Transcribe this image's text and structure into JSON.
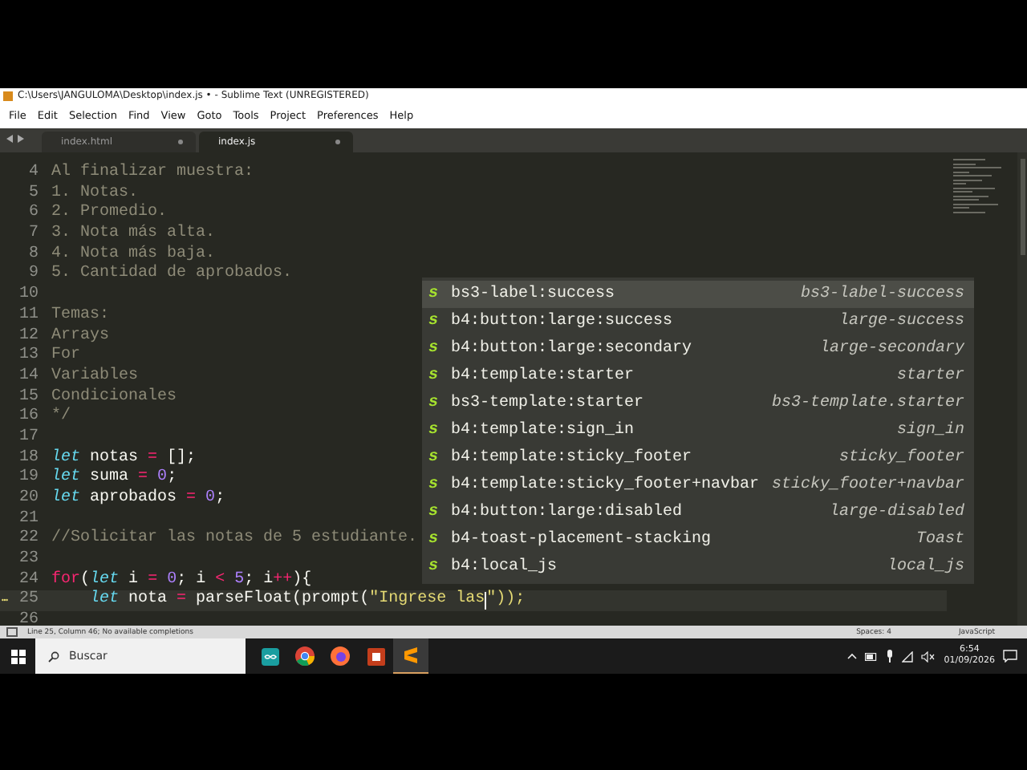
{
  "window": {
    "title": "C:\\Users\\JANGULOMA\\Desktop\\index.js • - Sublime Text (UNREGISTERED)"
  },
  "menu": [
    "File",
    "Edit",
    "Selection",
    "Find",
    "View",
    "Goto",
    "Tools",
    "Project",
    "Preferences",
    "Help"
  ],
  "tabs": [
    {
      "label": "index.html",
      "selected": false
    },
    {
      "label": "index.js",
      "selected": true
    }
  ],
  "editor": {
    "lines": [
      {
        "number": "4",
        "current": false,
        "modified": false,
        "tokens": [
          {
            "kind": "comment",
            "text": "Al finalizar muestra:"
          }
        ]
      },
      {
        "number": "5",
        "current": false,
        "modified": false,
        "tokens": [
          {
            "kind": "comment",
            "text": "1. Notas."
          }
        ]
      },
      {
        "number": "6",
        "current": false,
        "modified": false,
        "tokens": [
          {
            "kind": "comment",
            "text": "2. Promedio."
          }
        ]
      },
      {
        "number": "7",
        "current": false,
        "modified": false,
        "tokens": [
          {
            "kind": "comment",
            "text": "3. Nota más alta."
          }
        ]
      },
      {
        "number": "8",
        "current": false,
        "modified": false,
        "tokens": [
          {
            "kind": "comment",
            "text": "4. Nota más baja."
          }
        ]
      },
      {
        "number": "9",
        "current": false,
        "modified": false,
        "tokens": [
          {
            "kind": "comment",
            "text": "5. Cantidad de aprobados."
          }
        ]
      },
      {
        "number": "10",
        "current": false,
        "modified": false
      },
      {
        "number": "11",
        "current": false,
        "modified": false,
        "tokens": [
          {
            "kind": "comment",
            "text": "Temas:"
          }
        ]
      },
      {
        "number": "12",
        "current": false,
        "modified": false,
        "tokens": [
          {
            "kind": "comment",
            "text": "Arrays"
          }
        ]
      },
      {
        "number": "13",
        "current": false,
        "modified": false,
        "tokens": [
          {
            "kind": "comment",
            "text": "For"
          }
        ]
      },
      {
        "number": "14",
        "current": false,
        "modified": false,
        "tokens": [
          {
            "kind": "comment",
            "text": "Variables"
          }
        ]
      },
      {
        "number": "15",
        "current": false,
        "modified": false,
        "tokens": [
          {
            "kind": "comment",
            "text": "Condicionales"
          }
        ]
      },
      {
        "number": "16",
        "current": false,
        "modified": false,
        "tokens": [
          {
            "kind": "comment",
            "text": "*/"
          }
        ]
      },
      {
        "number": "17",
        "current": false,
        "modified": false
      },
      {
        "number": "18",
        "current": false,
        "modified": false,
        "tokens": [
          {
            "kind": "keyword",
            "text": "let"
          },
          {
            "kind": "plain",
            "text": " notas "
          },
          {
            "kind": "operator",
            "text": "="
          },
          {
            "kind": "plain",
            "text": " [];"
          }
        ]
      },
      {
        "number": "19",
        "current": false,
        "modified": false,
        "tokens": [
          {
            "kind": "keyword",
            "text": "let"
          },
          {
            "kind": "plain",
            "text": " suma "
          },
          {
            "kind": "operator",
            "text": "="
          },
          {
            "kind": "number",
            "text": " 0"
          },
          {
            "kind": "plain",
            "text": ";"
          }
        ]
      },
      {
        "number": "20",
        "current": false,
        "modified": false,
        "tokens": [
          {
            "kind": "keyword",
            "text": "let"
          },
          {
            "kind": "plain",
            "text": " aprobados "
          },
          {
            "kind": "operator",
            "text": "="
          },
          {
            "kind": "number",
            "text": " 0"
          },
          {
            "kind": "plain",
            "text": ";"
          }
        ]
      },
      {
        "number": "21",
        "current": false,
        "modified": false
      },
      {
        "number": "22",
        "current": false,
        "modified": false,
        "tokens": [
          {
            "kind": "comment",
            "text": "//Solicitar las notas de 5 estudiante."
          }
        ]
      },
      {
        "number": "23",
        "current": false,
        "modified": false
      },
      {
        "number": "24",
        "current": false,
        "modified": false,
        "tokens": [
          {
            "kind": "control",
            "text": "for"
          },
          {
            "kind": "plain",
            "text": "("
          },
          {
            "kind": "keyword",
            "text": "let"
          },
          {
            "kind": "plain",
            "text": " i "
          },
          {
            "kind": "operator",
            "text": "="
          },
          {
            "kind": "number",
            "text": " 0"
          },
          {
            "kind": "plain",
            "text": "; i "
          },
          {
            "kind": "operator",
            "text": "<"
          },
          {
            "kind": "number",
            "text": " 5"
          },
          {
            "kind": "plain",
            "text": "; i"
          },
          {
            "kind": "operator",
            "text": "++"
          },
          {
            "kind": "plain",
            "text": "){"
          }
        ]
      },
      {
        "number": "25",
        "current": true,
        "modified": true,
        "indent": true,
        "tokens": [
          {
            "kind": "keyword",
            "text": "let"
          },
          {
            "kind": "plain",
            "text": " nota "
          },
          {
            "kind": "operator",
            "text": "="
          },
          {
            "kind": "plain",
            "text": " parseFloat(prompt("
          },
          {
            "kind": "string",
            "text": "\"Ingrese las",
            "caret_after": true
          },
          {
            "kind": "string",
            "text": "\"));"
          }
        ]
      },
      {
        "number": "26",
        "current": false,
        "modified": false
      }
    ]
  },
  "completions": [
    {
      "badge": "s",
      "trigger": "bs3-label:success",
      "annotation": "bs3-label-success",
      "selected": true
    },
    {
      "badge": "s",
      "trigger": "b4:button:large:success",
      "annotation": "large-success",
      "selected": false
    },
    {
      "badge": "s",
      "trigger": "b4:button:large:secondary",
      "annotation": "large-secondary",
      "selected": false
    },
    {
      "badge": "s",
      "trigger": "b4:template:starter",
      "annotation": "starter",
      "selected": false
    },
    {
      "badge": "s",
      "trigger": "bs3-template:starter",
      "annotation": "bs3-template.starter",
      "selected": false
    },
    {
      "badge": "s",
      "trigger": "b4:template:sign_in",
      "annotation": "sign_in",
      "selected": false
    },
    {
      "badge": "s",
      "trigger": "b4:template:sticky_footer",
      "annotation": "sticky_footer",
      "selected": false
    },
    {
      "badge": "s",
      "trigger": "b4:template:sticky_footer+navbar",
      "annotation": "sticky_footer+navbar",
      "selected": false
    },
    {
      "badge": "s",
      "trigger": "b4:button:large:disabled",
      "annotation": "large-disabled",
      "selected": false
    },
    {
      "badge": "s",
      "trigger": "b4-toast-placement-stacking",
      "annotation": "Toast",
      "selected": false
    },
    {
      "badge": "s",
      "trigger": "b4:local_js",
      "annotation": "local_js",
      "selected": false
    }
  ],
  "status_bar": {
    "position": "Line 25, Column 46; No available completions",
    "indentation": "Spaces: 4",
    "syntax": "JavaScript"
  },
  "taskbar": {
    "search_placeholder": "Buscar",
    "time": "6:54",
    "date": "01/09/2026"
  }
}
